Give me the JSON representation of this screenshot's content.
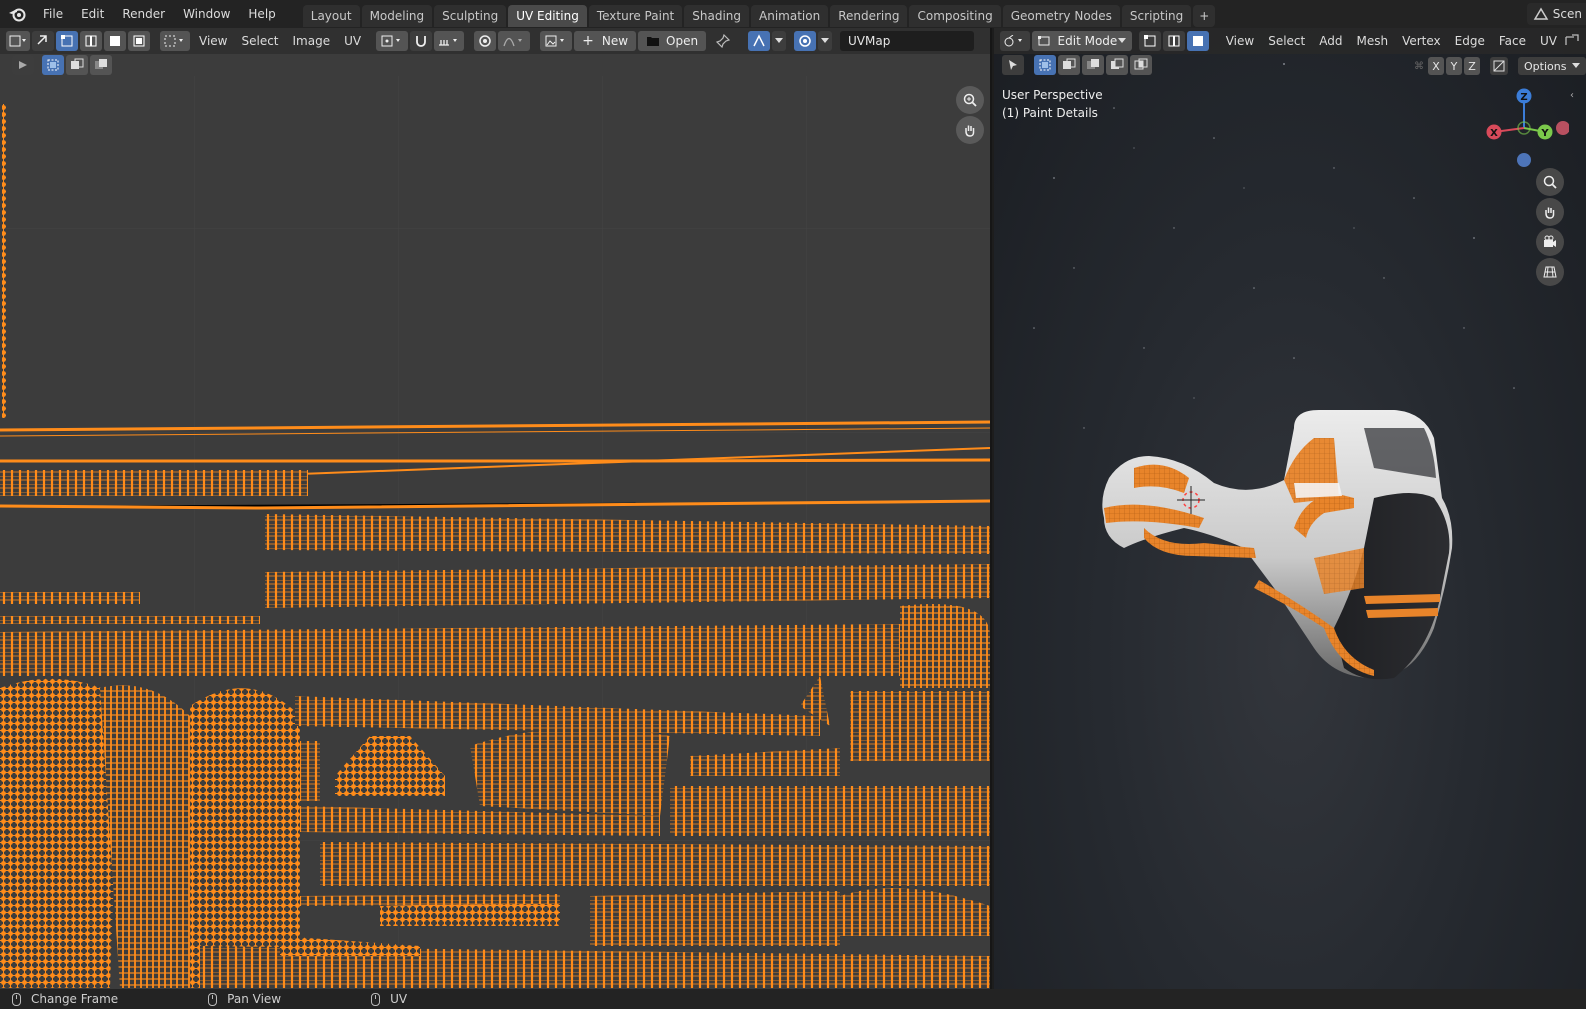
{
  "topbar": {
    "menus": [
      "File",
      "Edit",
      "Render",
      "Window",
      "Help"
    ],
    "workspaces": [
      "Layout",
      "Modeling",
      "Sculpting",
      "UV Editing",
      "Texture Paint",
      "Shading",
      "Animation",
      "Rendering",
      "Compositing",
      "Geometry Nodes",
      "Scripting"
    ],
    "active_workspace": "UV Editing",
    "add_workspace": "+",
    "scene_label": "Scen"
  },
  "uv_editor": {
    "menus": [
      "View",
      "Select",
      "Image",
      "UV"
    ],
    "new_label": "New",
    "open_label": "Open",
    "uv_map_name": "UVMap"
  },
  "viewport": {
    "mode": "Edit Mode",
    "menus": [
      "View",
      "Select",
      "Add",
      "Mesh",
      "Vertex",
      "Edge",
      "Face",
      "UV"
    ],
    "axes": [
      "X",
      "Y",
      "Z"
    ],
    "options_label": "Options",
    "perspective_label": "User Perspective",
    "object_label": "(1) Paint Details",
    "gizmo_labels": {
      "x": "X",
      "y": "Y",
      "z": "Z"
    }
  },
  "statusbar": {
    "items": [
      "Change Frame",
      "Pan View",
      "UV"
    ]
  },
  "colors": {
    "uv_orange": "#ff8c1a",
    "uv_bg": "#3c3c3c",
    "active_blue": "#4772b3"
  }
}
